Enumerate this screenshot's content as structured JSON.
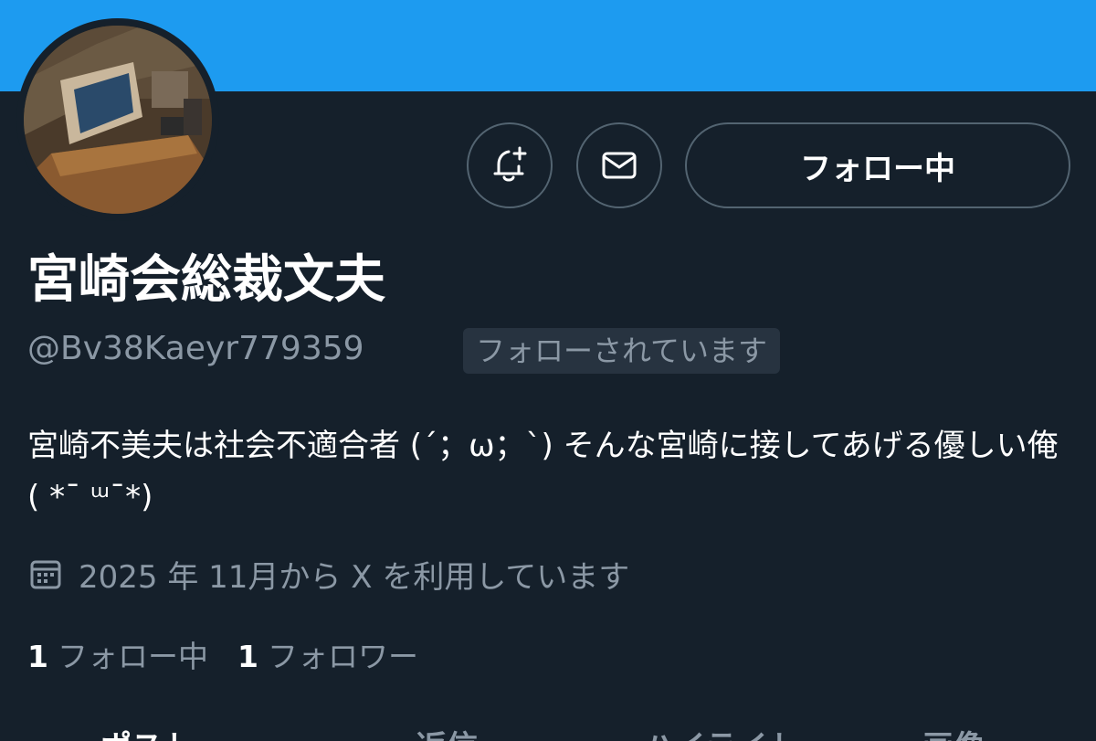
{
  "profile": {
    "display_name": "宮崎会総裁文夫",
    "handle": "@Bv38Kaeyr779359",
    "follows_you_badge": "フォローされています",
    "bio": "宮崎不美夫は社会不適合者 (´；ω；`) そんな宮崎に接してあげる優しい俺 ( *¯ ᵚ¯*)",
    "joined": "2025 年 11月から X を利用しています"
  },
  "actions": {
    "notifications_icon": "bell-plus-icon",
    "message_icon": "mail-icon",
    "following_button": "フォロー中"
  },
  "stats": {
    "following_count": "1",
    "following_label": "フォロー中",
    "followers_count": "1",
    "followers_label": "フォロワー"
  },
  "tabs": [
    {
      "label": "ポスト"
    },
    {
      "label": "返信"
    },
    {
      "label": "ハイライト"
    },
    {
      "label": "画像"
    }
  ],
  "colors": {
    "banner": "#1d9bf0",
    "background": "#15202b",
    "secondary_text": "#8b98a5",
    "border": "#536471"
  }
}
